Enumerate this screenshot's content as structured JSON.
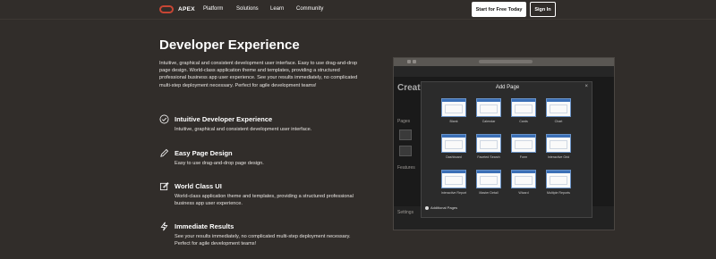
{
  "nav": {
    "logo_text": "APEX",
    "links": [
      "Platform",
      "Solutions",
      "Learn",
      "Community"
    ],
    "start_free": "Start for Free Today",
    "sign_in": "Sign In"
  },
  "main": {
    "title": "Developer Experience",
    "intro": "Intuitive, graphical and consistent development user interface. Easy to use drag-and-drop page design. World-class application theme and templates, providing a structured professional business app user experience. See your results immediately, no complicated multi-step deployment necessary. Perfect for agile development teams!",
    "features": [
      {
        "icon": "check-circle-icon",
        "title": "Intuitive Developer Experience",
        "desc": "Intuitive, graphical and consistent development user interface."
      },
      {
        "icon": "pencil-icon",
        "title": "Easy Page Design",
        "desc": "Easy to use drag-and-drop page design."
      },
      {
        "icon": "edit-square-icon",
        "title": "World Class UI",
        "desc": "World-class application theme and templates, providing a structured professional business app user experience."
      },
      {
        "icon": "lightning-icon",
        "title": "Immediate Results",
        "desc": "See your results immediately, no complicated multi-step deployment necessary. Perfect for agile development teams!"
      }
    ]
  },
  "screenshot": {
    "app_title": "Create",
    "bg_labels": [
      "Pages",
      "Features",
      "Settings"
    ],
    "modal": {
      "title": "Add Page",
      "close": "×",
      "pages": [
        "Blank",
        "Calendar",
        "Cards",
        "Chart",
        "Dashboard",
        "Faceted Search",
        "Form",
        "Interactive Grid",
        "Interactive Report",
        "Master Detail",
        "Wizard",
        "Multiple Reports"
      ],
      "additional": "Additional Pages"
    }
  }
}
